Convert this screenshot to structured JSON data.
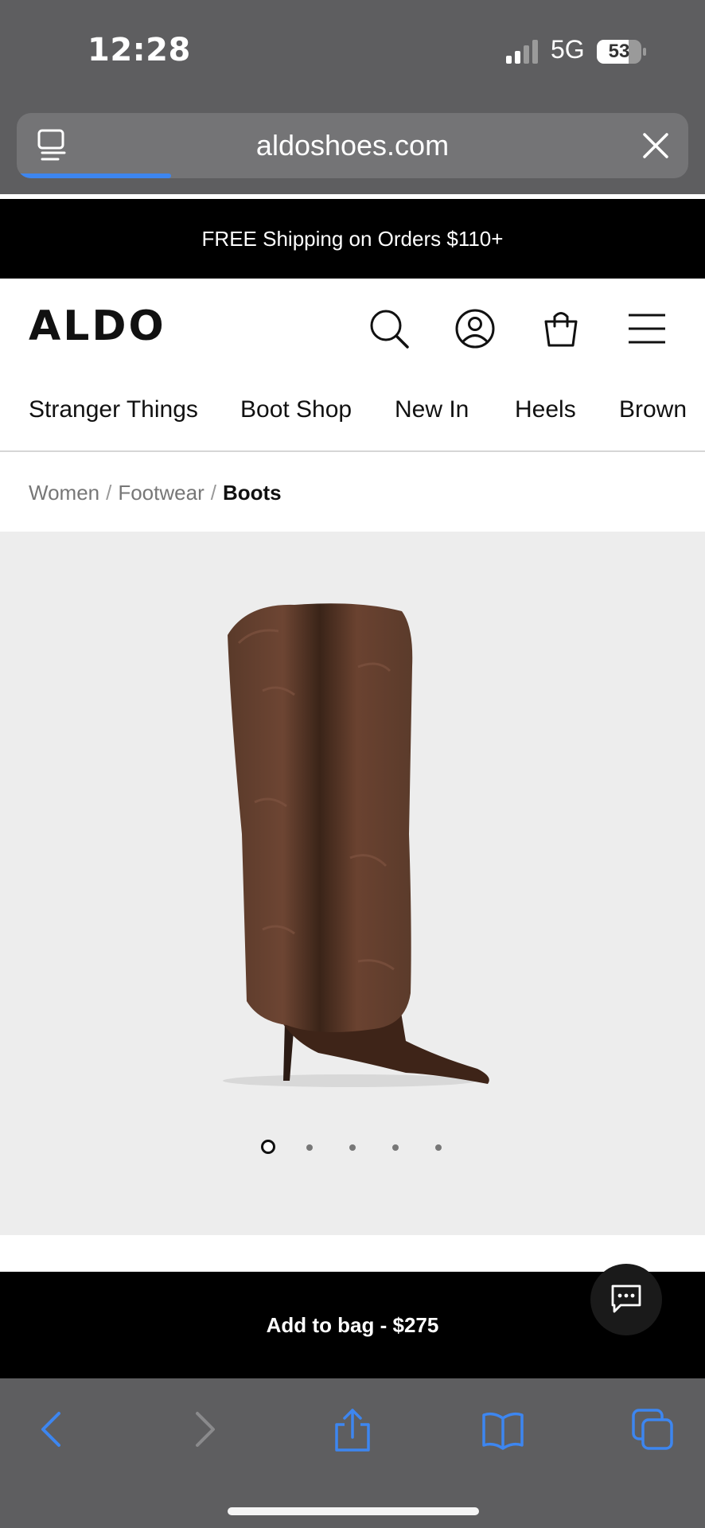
{
  "status_bar": {
    "time": "12:28",
    "network": "5G",
    "battery": "53"
  },
  "browser": {
    "url": "aldoshoes.com",
    "load_progress": 0.23
  },
  "promo": {
    "text": "FREE Shipping on Orders $110+"
  },
  "header": {
    "logo": "ALDO"
  },
  "categories": [
    "Stranger Things",
    "Boot Shop",
    "New In",
    "Heels",
    "Brown"
  ],
  "breadcrumb": {
    "items": [
      "Women",
      "Footwear"
    ],
    "current": "Boots"
  },
  "product": {
    "image_alt": "brown faux fur fold-over stiletto knee-high boot",
    "carousel_count": 5,
    "carousel_active": 1
  },
  "cta": {
    "label": "Add to bag - $275"
  },
  "icons": {
    "reader": "reader-mode-icon",
    "close": "close-icon",
    "search": "search-icon",
    "account": "account-icon",
    "bag": "shopping-bag-icon",
    "menu": "hamburger-menu-icon",
    "chat": "chat-icon",
    "back": "back-arrow-icon",
    "forward": "forward-arrow-icon",
    "share": "share-icon",
    "bookmarks": "bookmarks-icon",
    "tabs": "tabs-icon"
  },
  "colors": {
    "accent": "#3d86f0",
    "promo_bg": "#000000",
    "product_bg": "#ededed",
    "chrome": "#5e5e60"
  }
}
